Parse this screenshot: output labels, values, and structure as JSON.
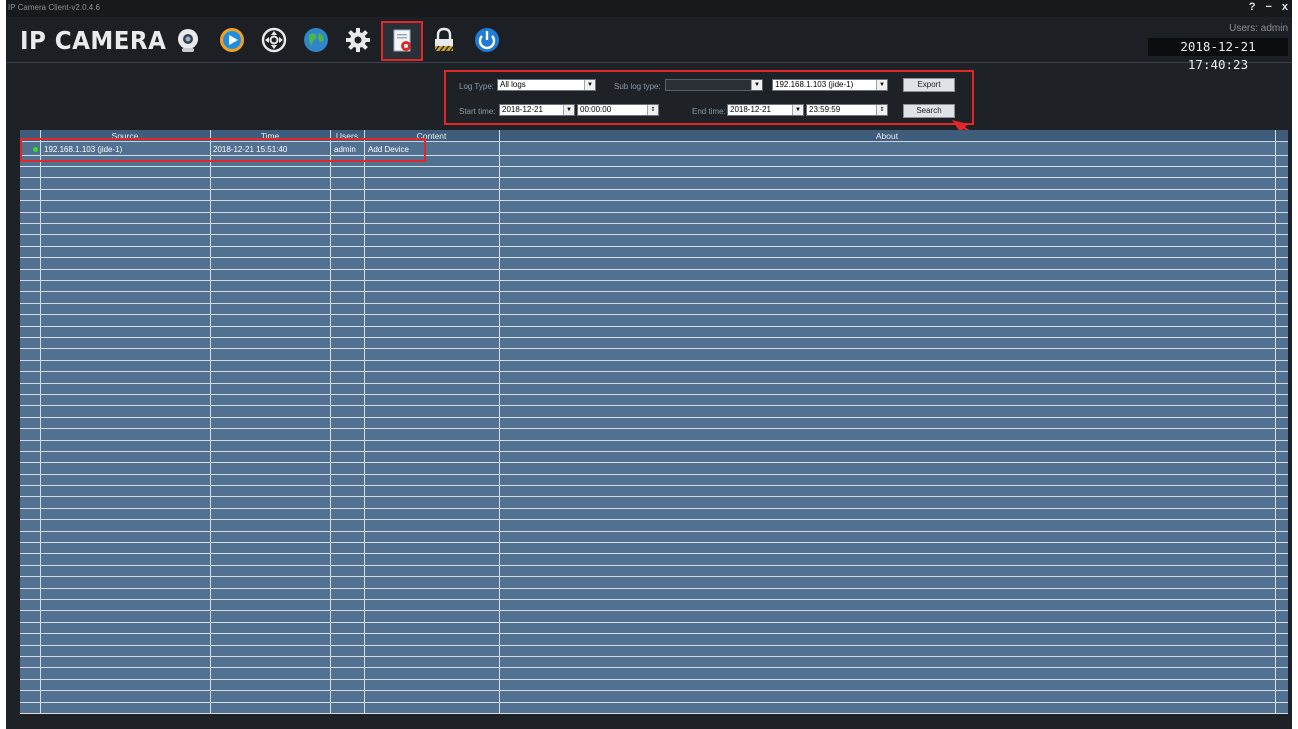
{
  "window": {
    "title": "IP Camera Client-v2.0.4.6",
    "help": "?",
    "minimize": "−",
    "close": "x"
  },
  "header": {
    "brand": "IP CAMERA",
    "user_label": "Users: admin",
    "clock": "2018-12-21 17:40:23",
    "toolbar": [
      {
        "name": "preview",
        "icon": "webcam-icon"
      },
      {
        "name": "playback",
        "icon": "play-icon"
      },
      {
        "name": "ptz",
        "icon": "ptz-wheel-icon"
      },
      {
        "name": "network",
        "icon": "globe-icon"
      },
      {
        "name": "settings",
        "icon": "gear-icon"
      },
      {
        "name": "logs",
        "icon": "log-record-icon",
        "active": true
      },
      {
        "name": "lock",
        "icon": "lock-icon"
      },
      {
        "name": "exit",
        "icon": "power-icon"
      }
    ]
  },
  "filters": {
    "log_type_label": "Log Type:",
    "log_type_value": "All logs",
    "sub_log_type_label": "Sub log type:",
    "sub_log_type_value": "",
    "device_value": "192.168.1.103 (jide-1)",
    "export_label": "Export",
    "start_time_label": "Start time:",
    "start_date": "2018-12-21",
    "start_time": "00:00:00",
    "end_time_label": "End time:",
    "end_date": "2018-12-21",
    "end_time": "23:59:59",
    "search_label": "Search"
  },
  "table": {
    "columns": [
      "Source",
      "Time",
      "Users",
      "Content",
      "About"
    ],
    "rows": [
      {
        "source": "192.168.1.103 (jide-1)",
        "time": "2018-12-21 15:51:40",
        "user": "admin",
        "content": "Add Device",
        "about": ""
      }
    ]
  },
  "colors": {
    "highlight": "#e02828",
    "table_bg": "#527191",
    "status_online": "#2ce02c"
  }
}
